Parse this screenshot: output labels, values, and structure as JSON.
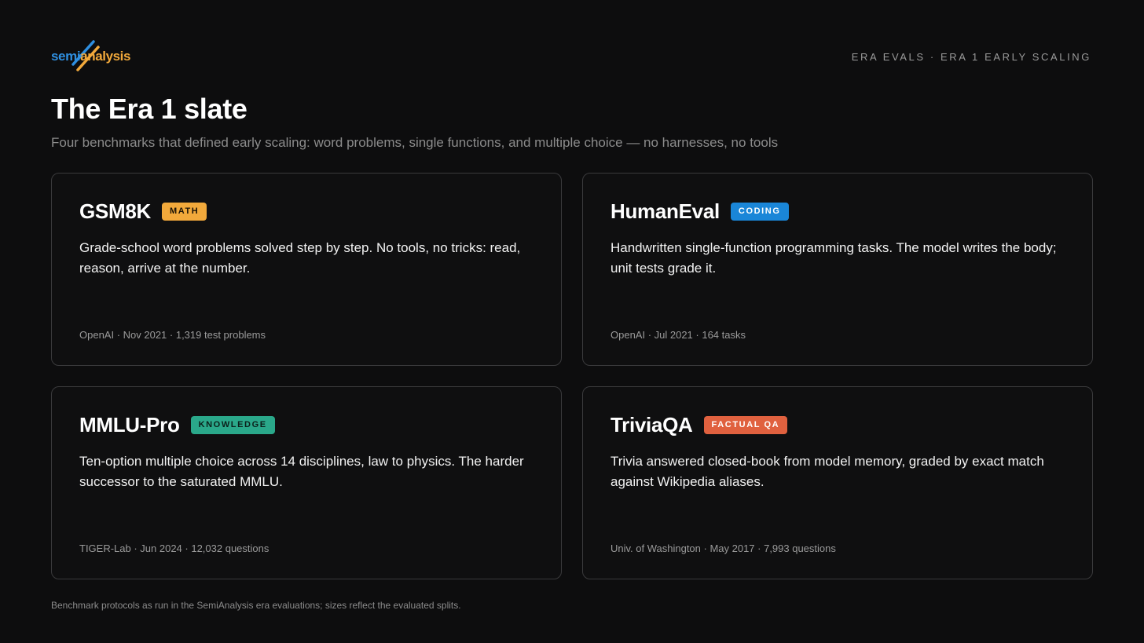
{
  "logo": {
    "semi": "semi",
    "analysis": "analysis",
    "primary_color": "#2f8fe0",
    "accent_color": "#f2a93b"
  },
  "header": {
    "tag": "ERA EVALS · ERA 1 EARLY SCALING"
  },
  "title": "The Era 1 slate",
  "subtitle": "Four benchmarks that defined early scaling: word problems, single functions, and multiple choice — no harnesses, no tools",
  "cards": [
    {
      "name": "GSM8K",
      "badge": "MATH",
      "badge_color": "#f2a93b",
      "description": "Grade-school word problems solved step by step. No tools, no tricks: read, reason, arrive at the number.",
      "meta": "OpenAI · Nov 2021 · 1,319 test problems"
    },
    {
      "name": "HumanEval",
      "badge": "CODING",
      "badge_color": "#1a86d8",
      "description": "Handwritten single-function programming tasks. The model writes the body; unit tests grade it.",
      "meta": "OpenAI · Jul 2021 · 164 tasks"
    },
    {
      "name": "MMLU-Pro",
      "badge": "KNOWLEDGE",
      "badge_color": "#2aa88a",
      "description": "Ten-option multiple choice across 14 disciplines, law to physics. The harder successor to the saturated MMLU.",
      "meta": "TIGER-Lab · Jun 2024 · 12,032 questions"
    },
    {
      "name": "TriviaQA",
      "badge": "FACTUAL QA",
      "badge_color": "#e0613f",
      "description": "Trivia answered closed-book from model memory, graded by exact match against Wikipedia aliases.",
      "meta": "Univ. of Washington · May 2017 · 7,993 questions"
    }
  ],
  "footnote": "Benchmark protocols as run in the SemiAnalysis era evaluations; sizes reflect the evaluated splits."
}
